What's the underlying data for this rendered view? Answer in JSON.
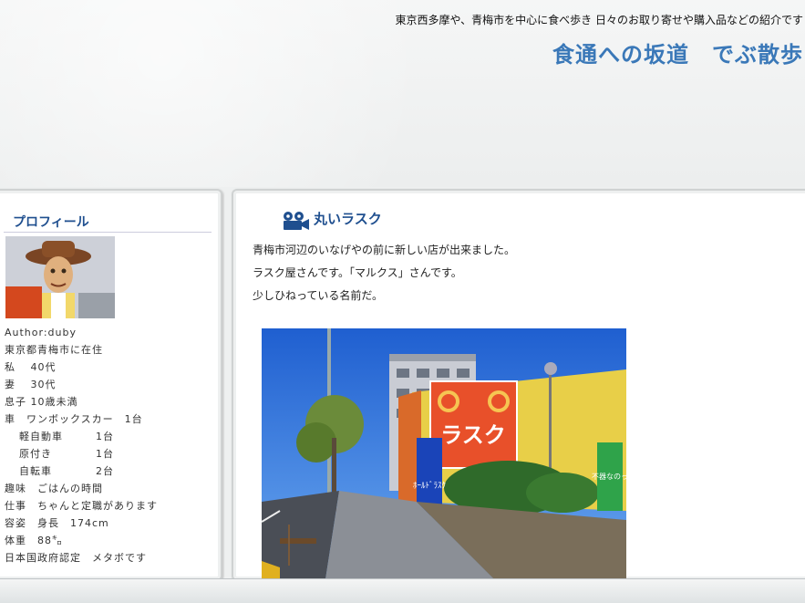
{
  "header": {
    "tagline": "東京西多摩や、青梅市を中心に食べ歩き 日々のお取り寄せや購入品などの紹介です",
    "title": "食通への坂道　でぶ散歩"
  },
  "sidebar": {
    "heading": "プロフィール",
    "avatar_icon": "woody-avatar",
    "author": "Author:duby",
    "lines": [
      {
        "text": "東京都青梅市に在住",
        "indent": false
      },
      {
        "text": "私　 40代",
        "indent": false
      },
      {
        "text": "妻　 30代",
        "indent": false
      },
      {
        "text": "息子  10歳未満",
        "indent": false
      },
      {
        "text": "車　ワンボックスカー　1台",
        "indent": false
      },
      {
        "text": "軽自動車　　　1台",
        "indent": true
      },
      {
        "text": "原付き　　　　1台",
        "indent": true
      },
      {
        "text": "自転車　　　　2台",
        "indent": true
      },
      {
        "text": "趣味　ごはんの時間",
        "indent": false
      },
      {
        "text": "仕事　ちゃんと定職があります",
        "indent": false
      },
      {
        "text": "容姿　身長　174cm",
        "indent": false
      },
      {
        "text": "体重　88㌔",
        "indent": false
      },
      {
        "text": "日本国政府認定　メタボです",
        "indent": false
      }
    ]
  },
  "post": {
    "icon": "film-camera-icon",
    "title": "丸いラスク",
    "paragraphs": [
      "青梅市河辺のいなげやの前に新しい店が出来ました。",
      "ラスク屋さんです。「マルクス」さんです。",
      "少しひねっている名前だ。"
    ],
    "photo": {
      "sign_text": "ラスク",
      "banner_text": "ﾎｰﾙﾄﾞﾗｽｸ",
      "green_banner_text": "不器なのっ"
    }
  },
  "colors": {
    "title_blue": "#3a78b8",
    "heading_blue": "#1f4f8f",
    "sign_red": "#e8502a"
  }
}
